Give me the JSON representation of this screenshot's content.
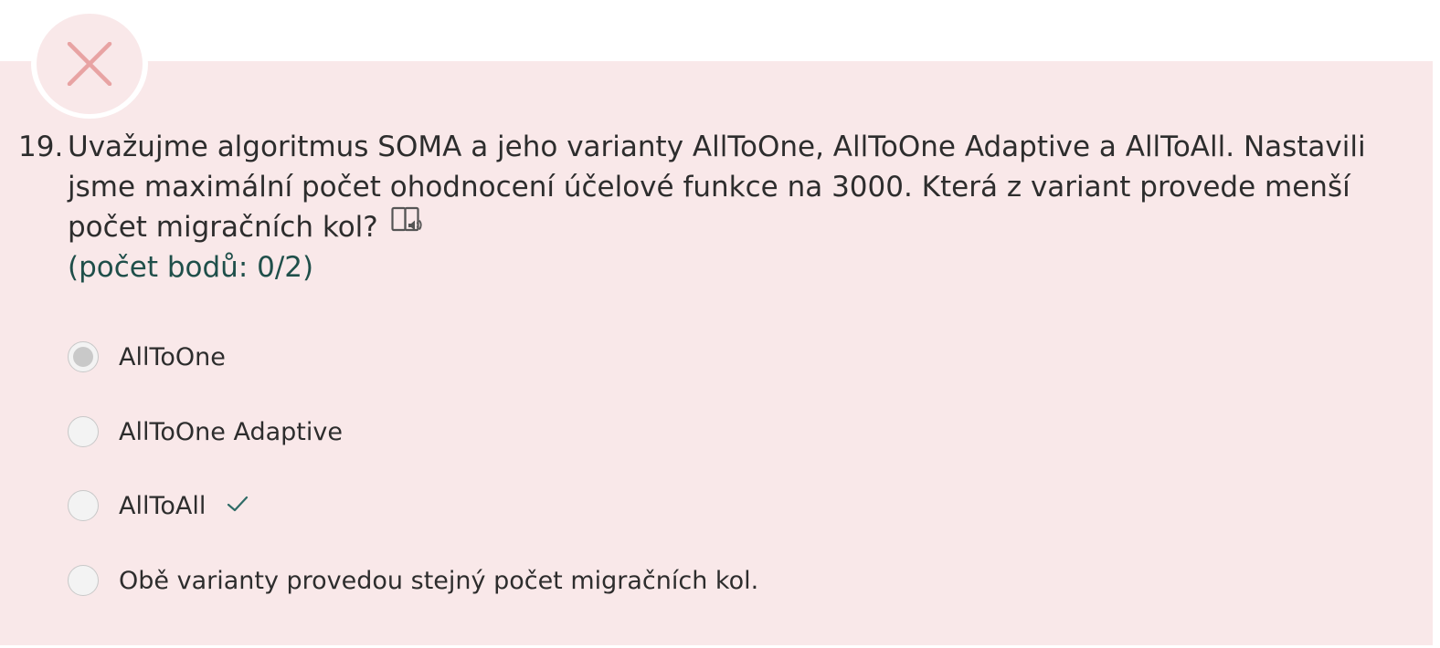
{
  "question": {
    "number": "19.",
    "text": "Uvažujme algoritmus SOMA a jeho varianty AllToOne, AllToOne Adaptive a AllToAll. Nastavili jsme maximální počet ohodnocení účelové funkce na 3000. Která z variant provede menší počet migračních kol?",
    "score": "(počet bodů: 0/2)",
    "status_icon": "close-icon",
    "audio_icon": "read-aloud-icon"
  },
  "options": [
    {
      "label": "AllToOne",
      "selected": true,
      "correct": false
    },
    {
      "label": "AllToOne Adaptive",
      "selected": false,
      "correct": false
    },
    {
      "label": "AllToAll",
      "selected": false,
      "correct": true
    },
    {
      "label": "Obě varianty provedou stejný počet migračních kol.",
      "selected": false,
      "correct": false
    }
  ],
  "colors": {
    "panel_background": "#f9e8e9",
    "wrong_mark": "#e8a3a3",
    "score_text": "#1f4f4a",
    "correct_check": "#2f6b66"
  }
}
